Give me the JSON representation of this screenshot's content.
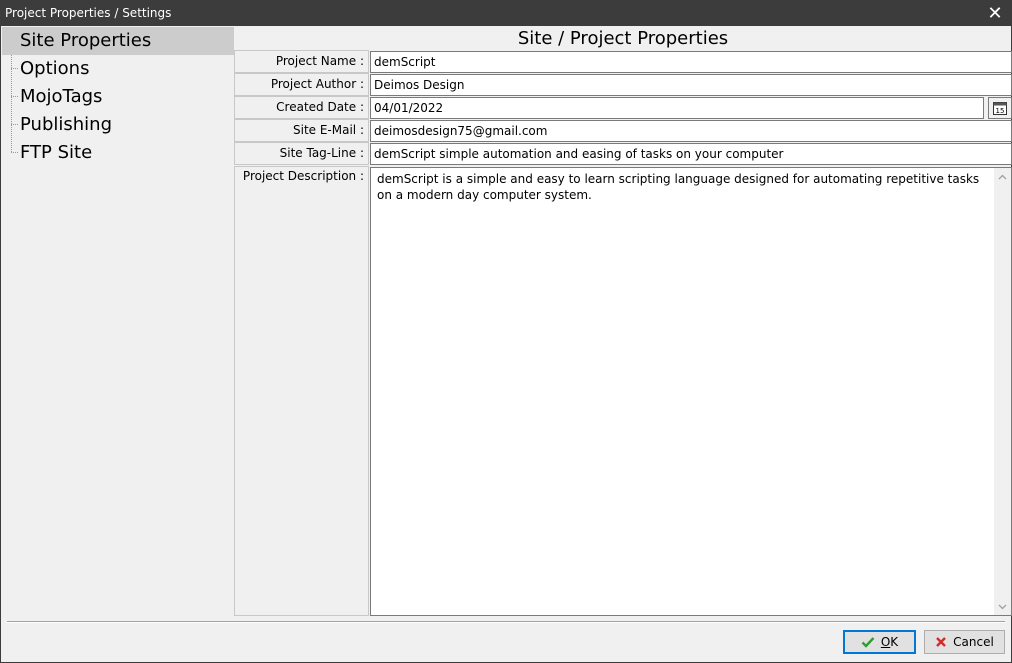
{
  "window": {
    "title": "Project Properties / Settings"
  },
  "tree": {
    "items": [
      {
        "label": "Site Properties",
        "selected": true
      },
      {
        "label": "Options",
        "selected": false
      },
      {
        "label": "MojoTags",
        "selected": false
      },
      {
        "label": "Publishing",
        "selected": false
      },
      {
        "label": "FTP Site",
        "selected": false
      }
    ]
  },
  "panel": {
    "title": "Site / Project Properties",
    "fields": {
      "project_name": {
        "label": "Project Name :",
        "value": "demScript"
      },
      "project_author": {
        "label": "Project Author :",
        "value": "Deimos Design"
      },
      "created_date": {
        "label": "Created Date :",
        "value": "04/01/2022",
        "calendar_day": "15"
      },
      "site_email": {
        "label": "Site E-Mail :",
        "value": "deimosdesign75@gmail.com"
      },
      "site_tagline": {
        "label": "Site Tag-Line :",
        "value": "demScript simple automation and easing of tasks on your computer"
      },
      "project_description": {
        "label": "Project Description :",
        "value": "demScript is a simple and easy to learn scripting language designed for automating repetitive tasks on a modern day computer system."
      }
    }
  },
  "buttons": {
    "ok": {
      "label": "OK",
      "mnemonic": "O",
      "rest": "K"
    },
    "cancel": {
      "label": "Cancel"
    }
  },
  "colors": {
    "titlebar": "#3c3c3c",
    "ok_check": "#2e9e2e",
    "cancel_x": "#d42a2a",
    "focus": "#0078d7"
  },
  "icons": [
    "close-icon",
    "calendar-icon",
    "checkmark-icon",
    "cross-icon",
    "chevron-up-icon",
    "chevron-down-icon"
  ]
}
